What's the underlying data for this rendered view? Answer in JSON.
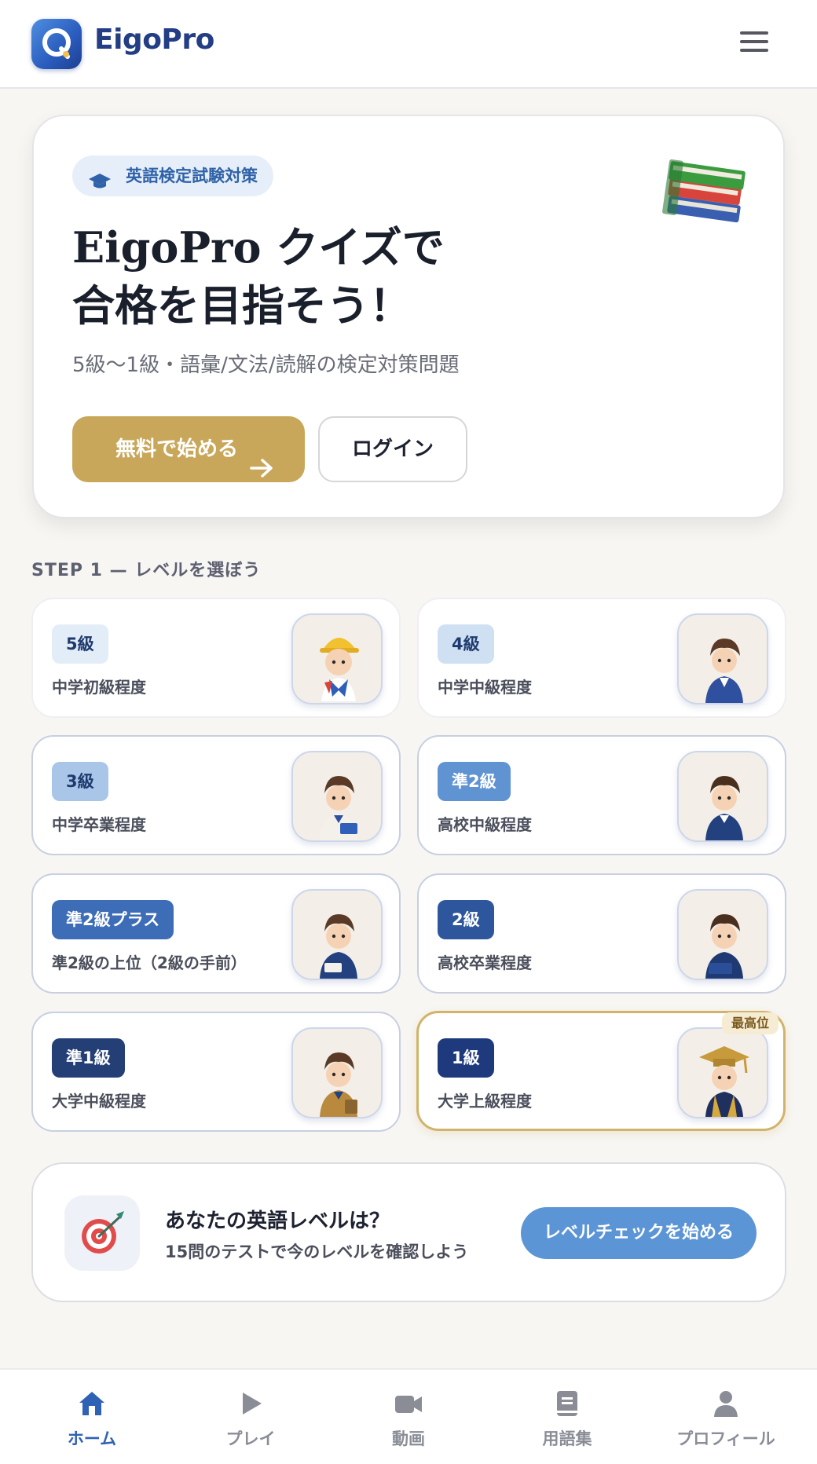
{
  "app": {
    "title": "EigoPro"
  },
  "colors": {
    "brand": "#2a5bbd",
    "accent_gold": "#c9a75a",
    "check_button": "#5b95d6",
    "active_nav": "#2f62b4"
  },
  "hero": {
    "badge": "英語検定試験対策",
    "title_line1": "EigoPro クイズで",
    "title_line2": "合格を目指そう！",
    "subtitle": "5級〜1級・語彙/文法/読解の検定対策問題",
    "primary_button": "無料で始める",
    "login_button": "ログイン",
    "icons": [
      "graduation-cap-icon",
      "books-icon",
      "arrow-right-icon"
    ]
  },
  "step1": {
    "label": "STEP 1 — レベルを選ぼう",
    "levels": [
      {
        "grade": "5級",
        "desc": "中学初級程度",
        "pill_bg": "#e3edf8",
        "pill_fg": "#1f3a6e"
      },
      {
        "grade": "4級",
        "desc": "中学中級程度",
        "pill_bg": "#cfe0f3",
        "pill_fg": "#1f3a6e"
      },
      {
        "grade": "3級",
        "desc": "中学卒業程度",
        "pill_bg": "#a9c6e8",
        "pill_fg": "#1f3a6e"
      },
      {
        "grade": "準2級",
        "desc": "高校中級程度",
        "pill_bg": "#5f93d2",
        "pill_fg": "#ffffff"
      },
      {
        "grade": "準2級プラス",
        "desc": "準2級の上位（2級の手前）",
        "pill_bg": "#3e6db8",
        "pill_fg": "#ffffff"
      },
      {
        "grade": "2級",
        "desc": "高校卒業程度",
        "pill_bg": "#2e569d",
        "pill_fg": "#ffffff"
      },
      {
        "grade": "準1級",
        "desc": "大学中級程度",
        "pill_bg": "#233f75",
        "pill_fg": "#ffffff"
      },
      {
        "grade": "1級",
        "desc": "大学上級程度",
        "pill_bg": "#1f3a7c",
        "pill_fg": "#ffffff",
        "badge": "最高位"
      }
    ]
  },
  "level_check": {
    "title": "あなたの英語レベルは？",
    "subtitle": "15問のテストで今のレベルを確認しよう",
    "button": "レベルチェックを始める",
    "icon": "target-icon"
  },
  "bottom_nav": [
    {
      "label": "ホーム",
      "icon": "home-icon",
      "active": true
    },
    {
      "label": "プレイ",
      "icon": "play-icon",
      "active": false
    },
    {
      "label": "動画",
      "icon": "video-icon",
      "active": false
    },
    {
      "label": "用語集",
      "icon": "book-icon",
      "active": false
    },
    {
      "label": "プロフィール",
      "icon": "user-icon",
      "active": false
    }
  ]
}
